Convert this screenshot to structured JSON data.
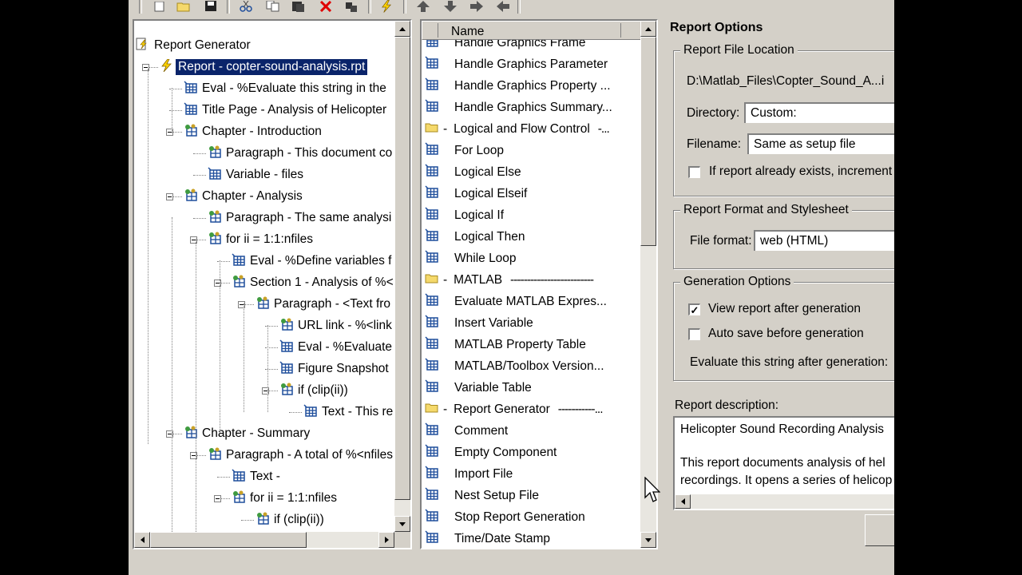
{
  "tree": {
    "items": [
      {
        "label": "Report Generator",
        "icon": "report-generator-icon"
      },
      {
        "label": "Report - copter-sound-analysis.rpt",
        "icon": "lightning-icon",
        "selected": true
      },
      {
        "label": "Eval - %Evaluate this string in the",
        "icon": "component-icon"
      },
      {
        "label": "Title Page - Analysis of Helicopter",
        "icon": "component-icon"
      },
      {
        "label": "Chapter - Introduction",
        "icon": "group-component-icon"
      },
      {
        "label": "Paragraph - This document co",
        "icon": "group-component-icon"
      },
      {
        "label": "Variable - files",
        "icon": "component-icon"
      },
      {
        "label": "Chapter - Analysis",
        "icon": "group-component-icon"
      },
      {
        "label": "Paragraph - The same analysi",
        "icon": "group-component-icon"
      },
      {
        "label": "for ii = 1:1:nfiles",
        "icon": "group-component-icon"
      },
      {
        "label": "Eval - %Define variables f",
        "icon": "component-icon"
      },
      {
        "label": "Section 1 - Analysis of %<",
        "icon": "group-component-icon"
      },
      {
        "label": "Paragraph - <Text fro",
        "icon": "group-component-icon"
      },
      {
        "label": "URL link - %<link",
        "icon": "group-component-icon"
      },
      {
        "label": "Eval - %Evaluate",
        "icon": "component-icon"
      },
      {
        "label": "Figure Snapshot",
        "icon": "component-icon"
      },
      {
        "label": "if (clip(ii))",
        "icon": "group-component-icon"
      },
      {
        "label": "Text - This re",
        "icon": "component-icon"
      },
      {
        "label": "Chapter - Summary",
        "icon": "group-component-icon"
      },
      {
        "label": "Paragraph - A total of %<nfiles",
        "icon": "group-component-icon"
      },
      {
        "label": "Text -",
        "icon": "component-icon"
      },
      {
        "label": "for ii = 1:1:nfiles",
        "icon": "group-component-icon"
      },
      {
        "label": "if (clip(ii))",
        "icon": "group-component-icon"
      }
    ]
  },
  "list": {
    "header": "Name",
    "items": [
      {
        "label": "Handle Graphics Frame",
        "icon": "component-icon"
      },
      {
        "label": "Handle Graphics Parameter",
        "icon": "component-icon"
      },
      {
        "label": "Handle Graphics Property ...",
        "icon": "component-icon"
      },
      {
        "label": "Handle Graphics Summary...",
        "icon": "component-icon"
      },
      {
        "label": "Logical and Flow Control",
        "icon": "folder-icon",
        "category": true,
        "tail": "-..."
      },
      {
        "label": "For Loop",
        "icon": "component-icon"
      },
      {
        "label": "Logical Else",
        "icon": "component-icon"
      },
      {
        "label": "Logical Elseif",
        "icon": "component-icon"
      },
      {
        "label": "Logical If",
        "icon": "component-icon"
      },
      {
        "label": "Logical Then",
        "icon": "component-icon"
      },
      {
        "label": "While Loop",
        "icon": "component-icon"
      },
      {
        "label": "MATLAB",
        "icon": "folder-icon",
        "category": true,
        "tail": "-------------------------"
      },
      {
        "label": "Evaluate MATLAB Expres...",
        "icon": "component-icon"
      },
      {
        "label": "Insert Variable",
        "icon": "component-icon"
      },
      {
        "label": "MATLAB Property Table",
        "icon": "component-icon"
      },
      {
        "label": "MATLAB/Toolbox Version...",
        "icon": "component-icon"
      },
      {
        "label": "Variable Table",
        "icon": "component-icon"
      },
      {
        "label": "Report Generator",
        "icon": "folder-icon",
        "category": true,
        "tail": "-----------..."
      },
      {
        "label": "Comment",
        "icon": "component-icon"
      },
      {
        "label": "Empty Component",
        "icon": "component-icon"
      },
      {
        "label": "Import File",
        "icon": "component-icon"
      },
      {
        "label": "Nest Setup File",
        "icon": "component-icon"
      },
      {
        "label": "Stop Report Generation",
        "icon": "component-icon"
      },
      {
        "label": "Time/Date Stamp",
        "icon": "component-icon"
      }
    ]
  },
  "options": {
    "title": "Report Options",
    "file_location": {
      "title": "Report File Location",
      "path": "D:\\Matlab_Files\\Copter_Sound_A...i",
      "directory_label": "Directory:",
      "directory_value": "Custom:",
      "filename_label": "Filename:",
      "filename_value": "Same as setup file",
      "increment_label": "If report already exists, increment"
    },
    "format": {
      "title": "Report Format and Stylesheet",
      "file_format_label": "File format:",
      "file_format_value": "web (HTML)"
    },
    "generation": {
      "title": "Generation Options",
      "view_report_label": "View report after generation",
      "view_report_checked": true,
      "auto_save_label": "Auto save before generation",
      "auto_save_checked": false,
      "evaluate_label": "Evaluate this string after generation:"
    },
    "description": {
      "label": "Report description:",
      "line1": "Helicopter Sound Recording Analysis",
      "line2": "This report documents analysis of  hel",
      "line3": "recordings. It opens a series of helicop"
    }
  },
  "colors": {
    "selection": "#0a246a",
    "chrome": "#d4d0c8",
    "folder": "#f5d96b",
    "component": "#1f4e9c"
  }
}
